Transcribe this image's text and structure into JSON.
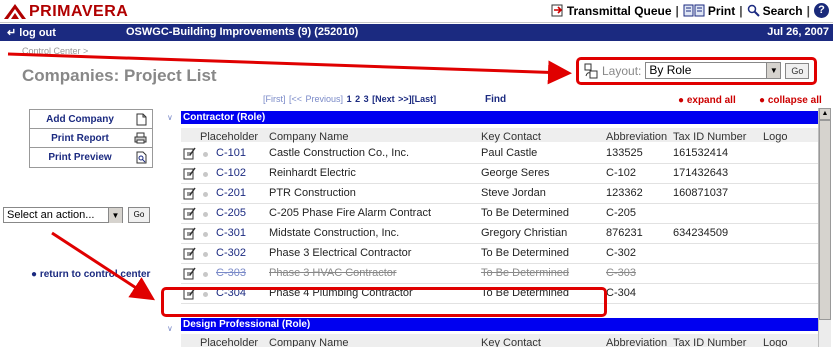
{
  "app": {
    "name": "PRIMAVERA"
  },
  "top_links": {
    "transmittal": "Transmittal Queue",
    "print": "Print",
    "search": "Search",
    "help": "?"
  },
  "navbar": {
    "logout": "log out",
    "project": "OSWGC-Building Improvements (9) (252010)",
    "date": "Jul 26, 2007"
  },
  "breadcrumb": "Control Center >",
  "title": "Companies: Project List",
  "layout": {
    "label": "Layout:",
    "value": "By Role",
    "go": "Go"
  },
  "pager": {
    "first": "[First]",
    "prev": "[<< Previous]",
    "p1": "1",
    "p2": "2",
    "p3": "3",
    "next": "[Next >>]",
    "last": "[Last]",
    "find": "Find",
    "expand_all": "expand all",
    "collapse_all": "collapse all"
  },
  "side_buttons": {
    "add": "Add Company",
    "report": "Print Report",
    "preview": "Print Preview"
  },
  "action": {
    "placeholder": "Select an action...",
    "go": "Go"
  },
  "return_link": "return to control center",
  "columns": {
    "placeholder": "Placeholder",
    "company": "Company Name",
    "key": "Key Contact",
    "abbr": "Abbreviation",
    "tax": "Tax ID Number",
    "logo": "Logo"
  },
  "groups": {
    "contractor": "Contractor (Role)",
    "design": "Design Professional (Role)"
  },
  "rows": [
    {
      "code": "C-101",
      "name": "Castle Construction Co., Inc.",
      "key": "Paul Castle",
      "abbr": "133525",
      "tax": "161532414"
    },
    {
      "code": "C-102",
      "name": "Reinhardt Electric",
      "key": "George Seres",
      "abbr": "C-102",
      "tax": "171432643"
    },
    {
      "code": "C-201",
      "name": "PTR Construction",
      "key": "Steve Jordan",
      "abbr": "123362",
      "tax": "160871037"
    },
    {
      "code": "C-205",
      "name": "C-205 Phase Fire Alarm Contract",
      "key": "To Be Determined",
      "abbr": "C-205",
      "tax": ""
    },
    {
      "code": "C-301",
      "name": "Midstate Construction, Inc.",
      "key": "Gregory Christian",
      "abbr": "876231",
      "tax": "634234509"
    },
    {
      "code": "C-302",
      "name": "Phase 3 Electrical Contractor",
      "key": "To Be Determined",
      "abbr": "C-302",
      "tax": ""
    },
    {
      "code": "C-303",
      "name": "Phase 3 HVAC Contractor",
      "key": "To Be Determined",
      "abbr": "C-303",
      "tax": ""
    },
    {
      "code": "C-304",
      "name": "Phase 4 Plumbing Contractor",
      "key": "To Be Determined",
      "abbr": "C-304",
      "tax": ""
    }
  ],
  "colors": {
    "navy": "#1b2a80",
    "group_blue": "#0000f0",
    "highlight": "#e00000",
    "logo_red": "#b00000"
  }
}
